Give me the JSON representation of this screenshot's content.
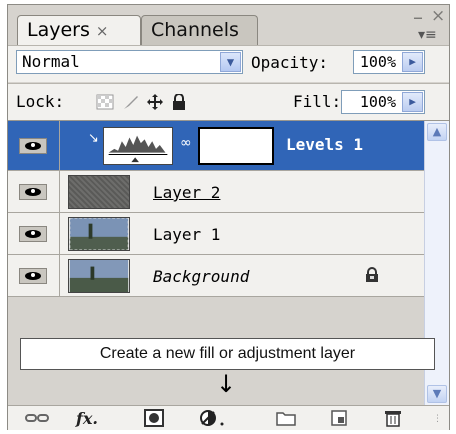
{
  "tabs": [
    {
      "label": "Layers",
      "close": "×"
    },
    {
      "label": "Channels"
    }
  ],
  "window": {
    "minimize": "–",
    "close": "×",
    "menu": "▾≡"
  },
  "blend_mode": "Normal",
  "opacity": {
    "label": "Opacity:",
    "value": "100%"
  },
  "lock": {
    "label": "Lock:"
  },
  "fill": {
    "label": "Fill:",
    "value": "100%"
  },
  "layers": [
    {
      "name": "Levels 1",
      "selected": true
    },
    {
      "name": "Layer 2"
    },
    {
      "name": "Layer 1"
    },
    {
      "name": "Background",
      "locked": true
    }
  ],
  "tooltip": "Create a new fill or adjustment layer",
  "pointer_arrow": "↓",
  "toolbar_icons": [
    "link-layers-icon",
    "layer-style-fx-icon",
    "add-mask-icon",
    "adjustment-layer-icon",
    "new-group-icon",
    "new-layer-icon",
    "delete-layer-icon"
  ],
  "toolbar_fx": "fx"
}
